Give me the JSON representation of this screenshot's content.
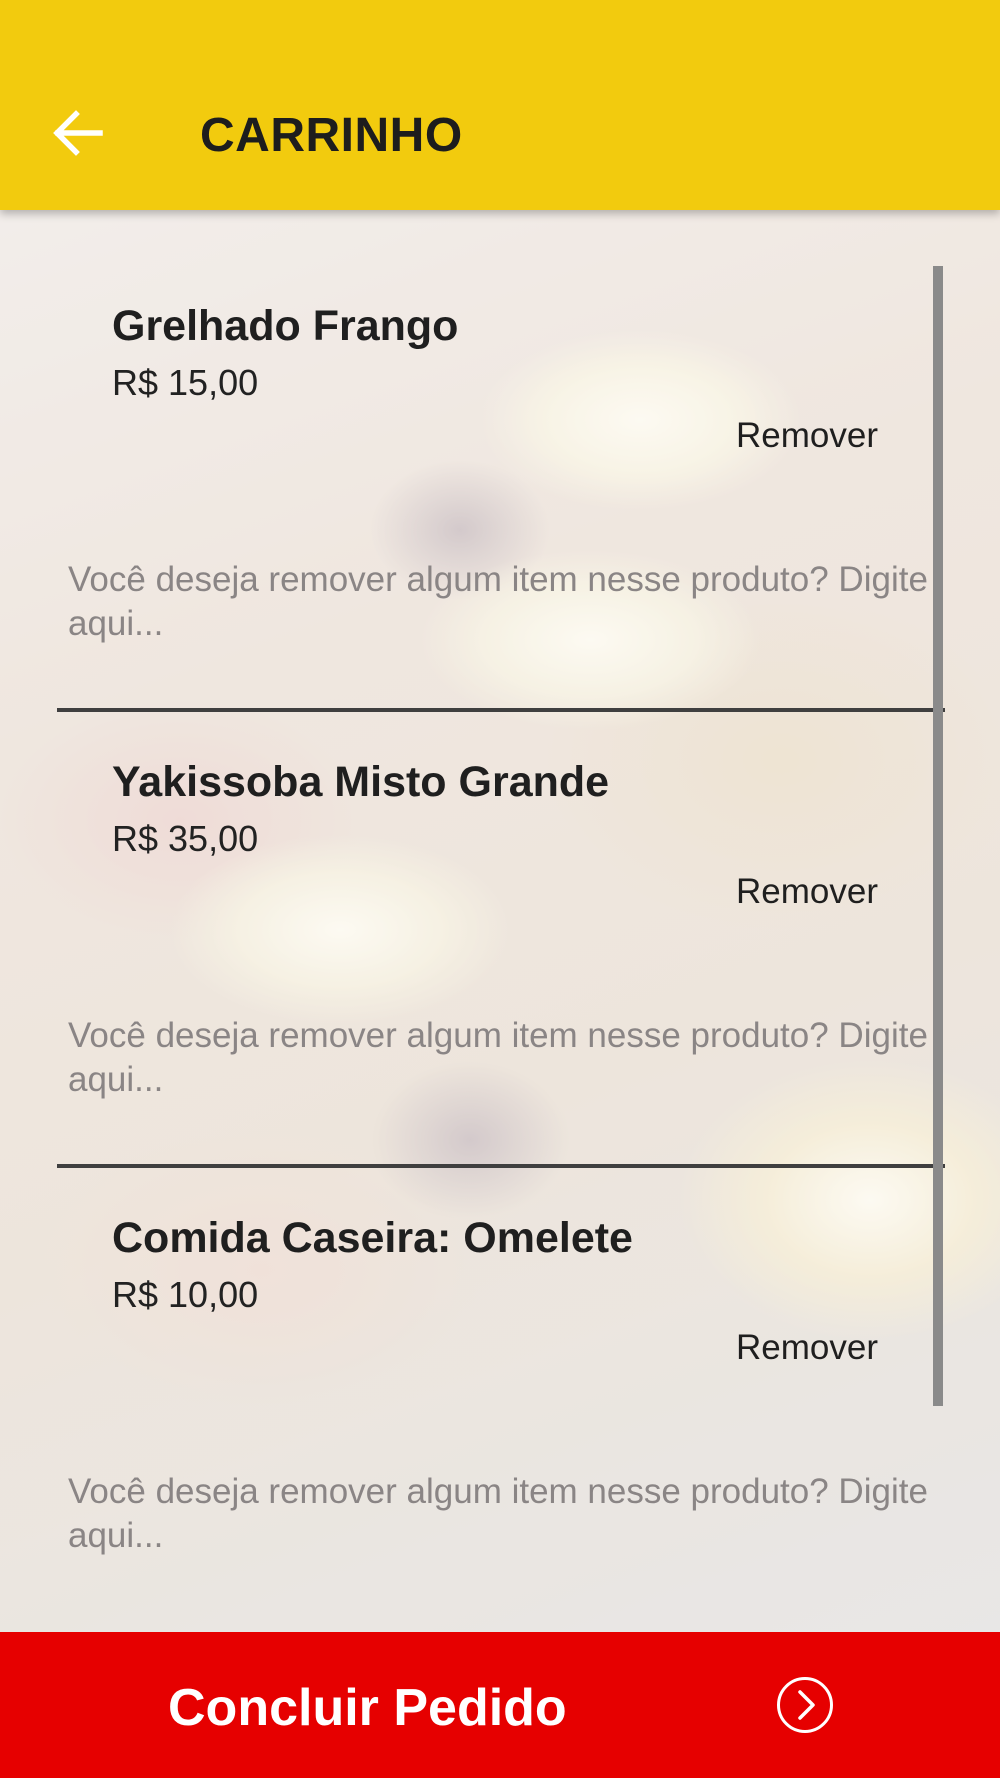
{
  "header": {
    "title": "CARRINHO",
    "back_icon": "arrow-left-icon",
    "background_color": "#f2cb0e"
  },
  "cart": {
    "items": [
      {
        "name": "Grelhado Frango",
        "price": "R$ 15,00",
        "remove_label": "Remover",
        "note_placeholder": "Você deseja remover algum item nesse produto? Digite aqui..."
      },
      {
        "name": "Yakissoba Misto Grande",
        "price": "R$ 35,00",
        "remove_label": "Remover",
        "note_placeholder": "Você deseja remover algum item nesse produto? Digite aqui..."
      },
      {
        "name": "Comida Caseira: Omelete",
        "price": "R$ 10,00",
        "remove_label": "Remover",
        "note_placeholder": "Você deseja remover algum item nesse produto? Digite aqui..."
      }
    ]
  },
  "footer": {
    "checkout_label": "Concluir Pedido",
    "checkout_icon": "chevron-right-circle-icon",
    "background_color": "#e60000"
  }
}
